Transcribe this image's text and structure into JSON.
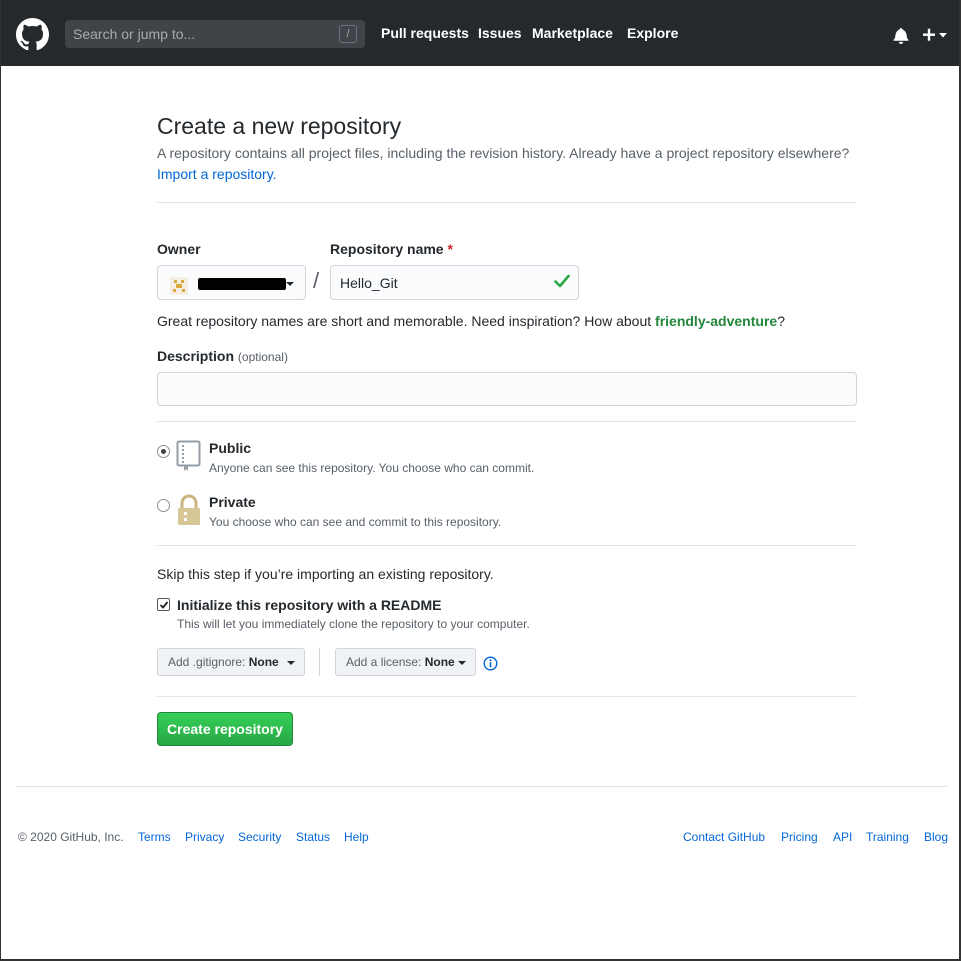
{
  "header": {
    "search_placeholder": "Search or jump to...",
    "slash_key": "/",
    "nav": [
      "Pull requests",
      "Issues",
      "Marketplace",
      "Explore"
    ]
  },
  "main": {
    "title": "Create a new repository",
    "subtitle": "A repository contains all project files, including the revision history. Already have a project repository elsewhere?",
    "import_link": "Import a repository.",
    "owner_label": "Owner",
    "repo_label": "Repository name",
    "required_mark": "*",
    "separator": "/",
    "repo_value": "Hello_Git",
    "hint_prefix": "Great repository names are short and memorable. Need inspiration? How about ",
    "hint_suggestion": "friendly-adventure",
    "hint_suffix": "?",
    "desc_label": "Description",
    "desc_optional": "(optional)",
    "desc_value": "",
    "visibility": [
      {
        "title": "Public",
        "desc": "Anyone can see this repository. You choose who can commit.",
        "selected": true
      },
      {
        "title": "Private",
        "desc": "You choose who can see and commit to this repository.",
        "selected": false
      }
    ],
    "skip_text": "Skip this step if you’re importing an existing repository.",
    "init_label": "Initialize this repository with a README",
    "init_desc": "This will let you immediately clone the repository to your computer.",
    "init_checked": true,
    "gitignore_label": "Add .gitignore:",
    "gitignore_value": "None",
    "license_label": "Add a license:",
    "license_value": "None",
    "create_button": "Create repository"
  },
  "footer": {
    "copyright": "© 2020 GitHub, Inc.",
    "left_links": [
      "Terms",
      "Privacy",
      "Security",
      "Status",
      "Help"
    ],
    "right_links": [
      "Contact GitHub",
      "Pricing",
      "API",
      "Training",
      "Blog"
    ]
  },
  "colors": {
    "header_bg": "#24292e",
    "link": "#0366d6",
    "primary_button": "#28a745",
    "suggestion": "#22863a",
    "required": "#cb2431"
  }
}
